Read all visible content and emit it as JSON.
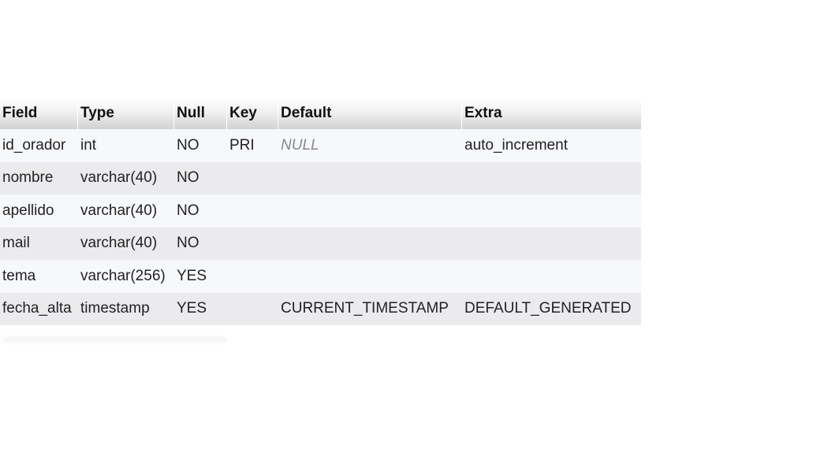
{
  "table": {
    "headers": [
      "Field",
      "Type",
      "Null",
      "Key",
      "Default",
      "Extra"
    ],
    "rows": [
      {
        "field": "id_orador",
        "type": "int",
        "null": "NO",
        "key": "PRI",
        "default": "NULL",
        "extra": "auto_increment"
      },
      {
        "field": "nombre",
        "type": "varchar(40)",
        "null": "NO",
        "key": "",
        "default": "",
        "extra": ""
      },
      {
        "field": "apellido",
        "type": "varchar(40)",
        "null": "NO",
        "key": "",
        "default": "",
        "extra": ""
      },
      {
        "field": "mail",
        "type": "varchar(40)",
        "null": "NO",
        "key": "",
        "default": "",
        "extra": ""
      },
      {
        "field": "tema",
        "type": "varchar(256)",
        "null": "YES",
        "key": "",
        "default": "",
        "extra": ""
      },
      {
        "field": "fecha_alta",
        "type": "timestamp",
        "null": "YES",
        "key": "",
        "default": "CURRENT_TIMESTAMP",
        "extra": "DEFAULT_GENERATED"
      }
    ]
  },
  "colors": {
    "header_gradient_bottom": "#d2d1d1",
    "row_odd": "#f7f8fa",
    "row_even": "#ebebed",
    "null_text": "#888888"
  }
}
